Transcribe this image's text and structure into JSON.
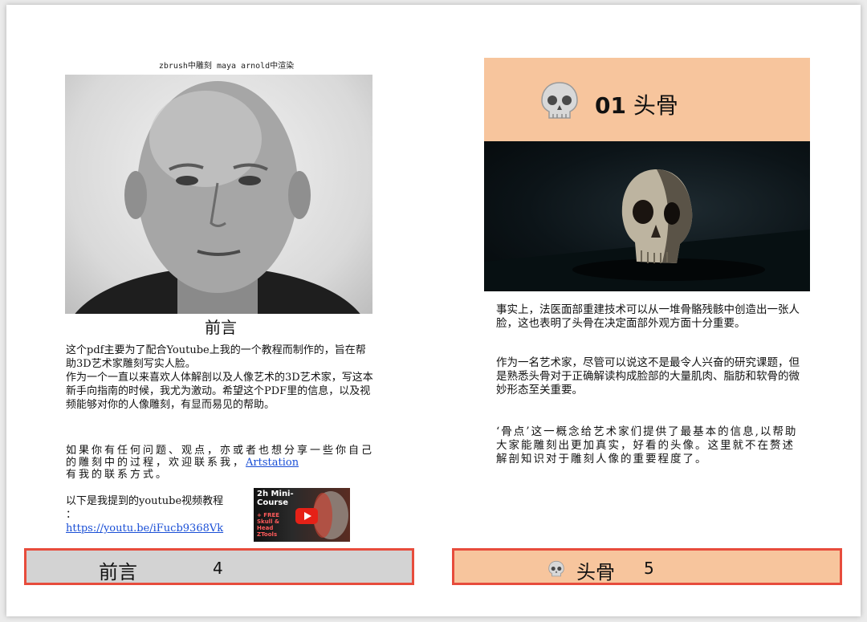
{
  "left_page": {
    "caption": "zbrush中雕刻 maya arnold中渲染",
    "heading": "前言",
    "paragraph1": "这个pdf主要为了配合Youtube上我的一个教程而制作的，旨在帮助3D艺术家雕刻写实人脸。",
    "paragraph2": "作为一个一直以来喜欢人体解剖以及人像艺术的3D艺术家，写这本新手向指南的时候，我尤为激动。希望这个PDF里的信息，以及视频能够对你的人像雕刻，有显而易见的帮助。",
    "paragraph3_before": "如果你有任何问题、观点，亦或者也想分享一些你自己的雕刻中的过程，欢迎联系我，",
    "paragraph3_link": "Artstation",
    "paragraph3_after": "有我的联系方式。",
    "paragraph4": "以下是我提到的youtube视频教程",
    "paragraph4_colon": "：",
    "video_link": "https://youtu.be/iFucb9368Vk",
    "thumbnail": {
      "title": "2h Mini-Course",
      "subtitle": "+ FREE Skull & Head ZTools"
    },
    "footer": {
      "label": "前言",
      "page": "4"
    }
  },
  "right_page": {
    "chapter_number": "01",
    "chapter_title": "头骨",
    "chapter_icon": "skull-icon",
    "paragraph1": "事实上，法医面部重建技术可以从一堆骨骼残骸中创造出一张人脸，这也表明了头骨在决定面部外观方面十分重要。",
    "paragraph2": "作为一名艺术家，尽管可以说这不是最令人兴奋的研究课题，但是熟悉头骨对于正确解读构成脸部的大量肌肉、脂肪和软骨的微妙形态至关重要。",
    "paragraph3": "‘骨点’这一概念给艺术家们提供了最基本的信息,以帮助大家能雕刻出更加真实，好看的头像。这里就不在赘述解剖知识对于雕刻人像的重要程度了。",
    "footer": {
      "label": "头骨",
      "page": "5",
      "icon": "skull-icon"
    }
  },
  "colors": {
    "accent_peach": "#f7c59d",
    "footer_gray": "#d3d3d3",
    "footer_border": "#e74c3c",
    "link_blue": "#1a4fd6"
  }
}
